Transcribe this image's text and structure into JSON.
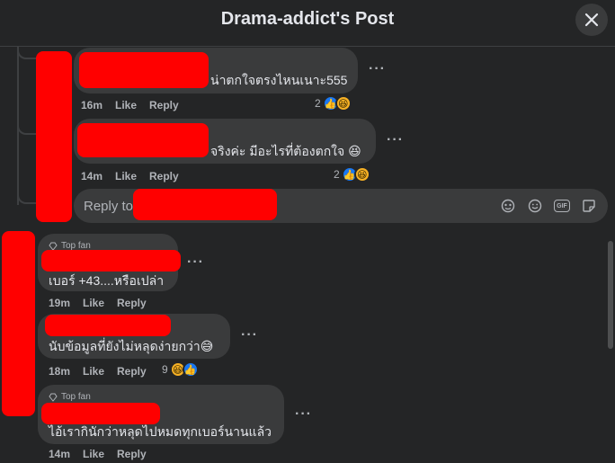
{
  "header": {
    "title": "Drama-addict's Post"
  },
  "replies": [
    {
      "text": "น่าตกใจตรงไหนเนาะ555",
      "time": "16m",
      "like": "Like",
      "reply": "Reply",
      "react_count": "2"
    },
    {
      "text": "จริงค่ะ มีอะไรที่ต้องตกใจ 😆",
      "time": "14m",
      "like": "Like",
      "reply": "Reply",
      "react_count": "2"
    }
  ],
  "reply_box": {
    "placeholder": "Reply to"
  },
  "comments": [
    {
      "badge": "Top fan",
      "text": "เบอร์ +43....หรือเปล่า",
      "time": "19m",
      "like": "Like",
      "reply": "Reply"
    },
    {
      "text": "นับข้อมูลที่ยังไม่หลุดง่ายกว่า😅",
      "time": "18m",
      "like": "Like",
      "reply": "Reply",
      "react_count": "9"
    },
    {
      "badge": "Top fan",
      "text": "ไอ้เรากินักว่าหลุดไปหมดทุกเบอร์นานแล้ว",
      "time": "14m",
      "like": "Like",
      "reply": "Reply"
    }
  ],
  "icons": {
    "close": "close-icon",
    "more": "more-options-icon",
    "like": "like-reaction-icon",
    "haha": "haha-reaction-icon",
    "sticker": "sticker-icon",
    "emoji": "emoji-icon",
    "gif": "gif-icon",
    "avatar_sticker": "avatar-sticker-icon"
  },
  "colors": {
    "background": "#242526",
    "bubble": "#3a3b3c",
    "like_blue": "#1877f2",
    "redaction": "#ff0000"
  }
}
